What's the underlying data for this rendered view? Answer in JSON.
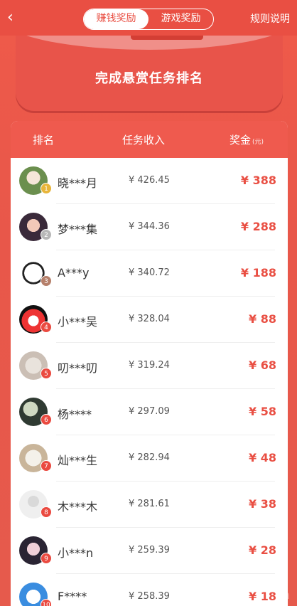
{
  "header": {
    "back_glyph": "‹",
    "tabs": [
      {
        "label": "赚钱奖励",
        "active": true
      },
      {
        "label": "游戏奖励",
        "active": false
      }
    ],
    "rules_label": "规则说明"
  },
  "banner": {
    "title": "完成悬赏任务排名"
  },
  "table": {
    "headers": {
      "rank": "排名",
      "income": "任务收入",
      "prize": "奖金",
      "prize_unit": "(元)"
    },
    "rows": [
      {
        "rank": "1",
        "name": "晓***月",
        "income": "¥ 426.45",
        "prize": "¥ 388",
        "medal": "gold"
      },
      {
        "rank": "2",
        "name": "梦***集",
        "income": "¥ 344.36",
        "prize": "¥ 288",
        "medal": "silver"
      },
      {
        "rank": "3",
        "name": "A***y",
        "income": "¥ 340.72",
        "prize": "¥ 188",
        "medal": "bronze"
      },
      {
        "rank": "4",
        "name": "小***吴",
        "income": "¥ 328.04",
        "prize": "¥ 88",
        "medal": "red"
      },
      {
        "rank": "5",
        "name": "叨***叨",
        "income": "¥ 319.24",
        "prize": "¥ 68",
        "medal": "red"
      },
      {
        "rank": "6",
        "name": "杨****",
        "income": "¥ 297.09",
        "prize": "¥ 58",
        "medal": "red"
      },
      {
        "rank": "7",
        "name": "灿***生",
        "income": "¥ 282.94",
        "prize": "¥ 48",
        "medal": "red"
      },
      {
        "rank": "8",
        "name": "木***木",
        "income": "¥ 281.61",
        "prize": "¥ 38",
        "medal": "red"
      },
      {
        "rank": "9",
        "name": "小***n",
        "income": "¥ 259.39",
        "prize": "¥ 28",
        "medal": "red"
      },
      {
        "rank": "10",
        "name": "F****",
        "income": "¥ 258.39",
        "prize": "¥ 18",
        "medal": "red"
      }
    ]
  },
  "colors": {
    "primary": "#e94f43",
    "background": "#ef5a4a"
  }
}
